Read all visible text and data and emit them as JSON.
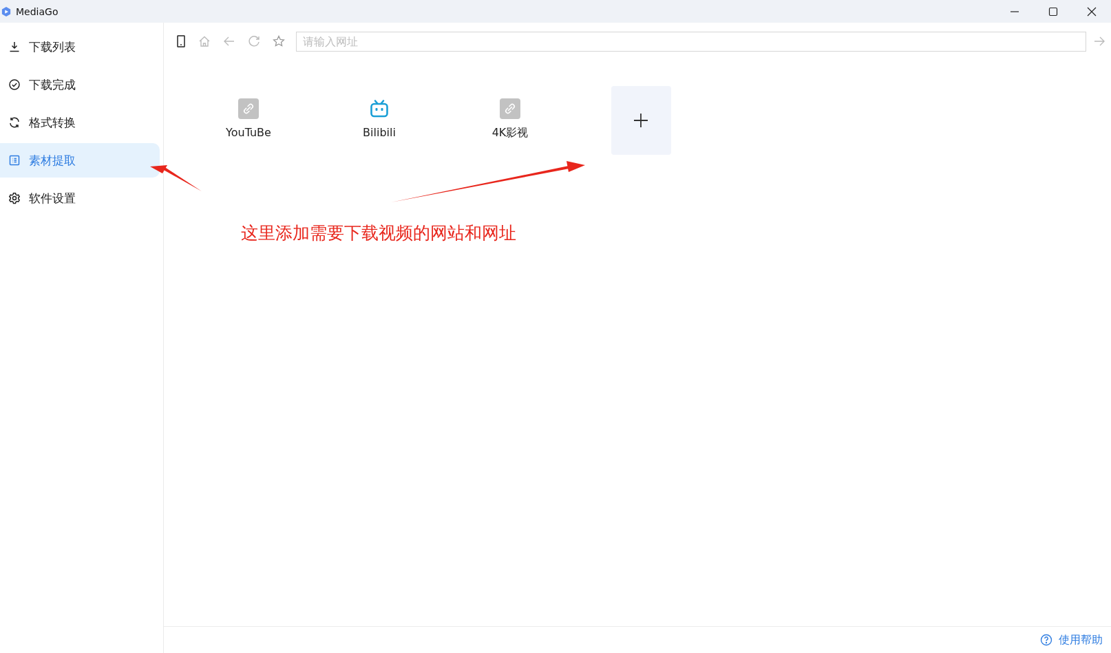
{
  "window": {
    "title": "MediaGo"
  },
  "sidebar": {
    "items": [
      {
        "label": "下载列表",
        "selected": false
      },
      {
        "label": "下载完成",
        "selected": false
      },
      {
        "label": "格式转换",
        "selected": false
      },
      {
        "label": "素材提取",
        "selected": true
      },
      {
        "label": "软件设置",
        "selected": false
      }
    ]
  },
  "toolbar": {
    "url_field": {
      "placeholder": "请输入网址"
    }
  },
  "sites": [
    {
      "label": "YouTuBe",
      "kind": "link"
    },
    {
      "label": "Bilibili",
      "kind": "bilibili"
    },
    {
      "label": "4K影视",
      "kind": "link"
    }
  ],
  "annotation": {
    "text": "这里添加需要下载视频的网站和网址"
  },
  "footer": {
    "help": "使用帮助"
  }
}
